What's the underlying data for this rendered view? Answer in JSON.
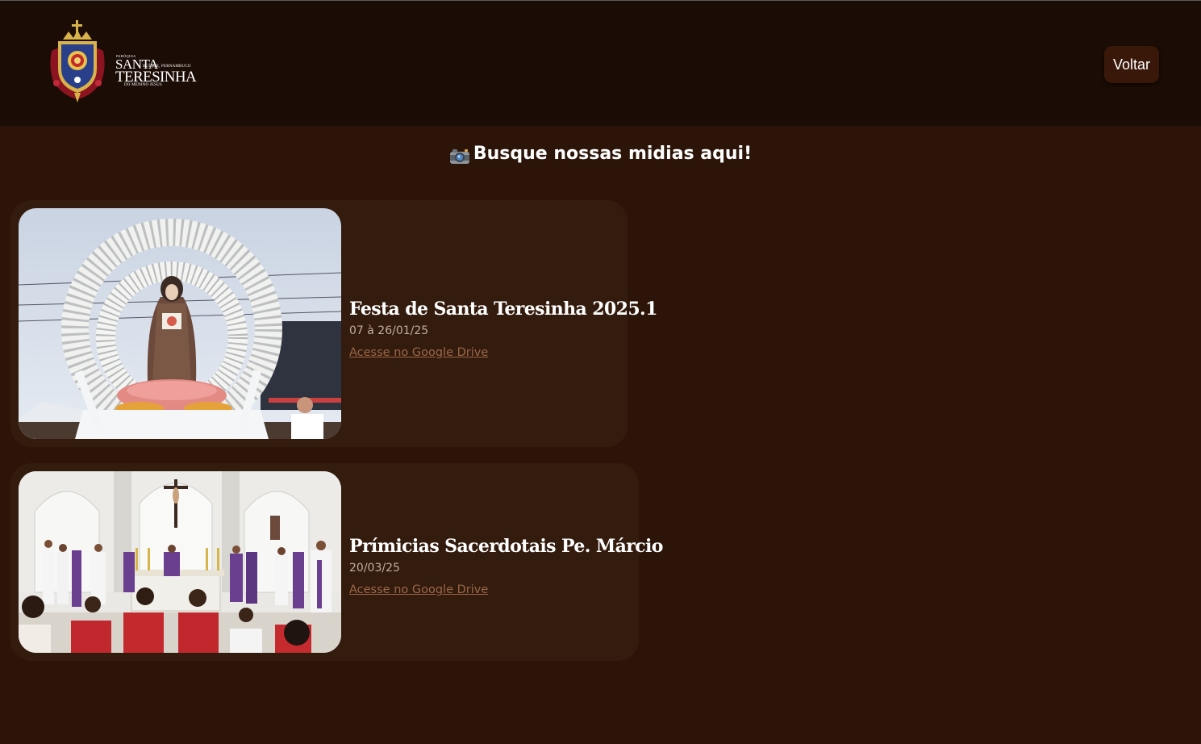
{
  "header": {
    "logo": {
      "line_parish": "PARÓQUIA",
      "line_santa": "SANTA",
      "line_city": "BUÍQUE, PERNAMBUCO",
      "line_teresinha": "TERESINHA",
      "line_menino": "DO MENINO JESUS"
    },
    "back_label": "Voltar"
  },
  "page": {
    "title": "Busque nossas midias aqui!",
    "title_icon": "camera-icon"
  },
  "albums": [
    {
      "title": "Festa de Santa Teresinha 2025.1",
      "date": "07 à 26/01/25",
      "link_label": "Acesse no Google Drive"
    },
    {
      "title": "Prímicias Sacerdotais Pe. Márcio",
      "date": "20/03/25",
      "link_label": "Acesse no Google Drive"
    }
  ],
  "colors": {
    "page_background": "#2c1508",
    "header_background": "#1b0c05",
    "card_background": "#331b0d",
    "button_background": "#3a1809",
    "link_color": "#9a6748"
  }
}
